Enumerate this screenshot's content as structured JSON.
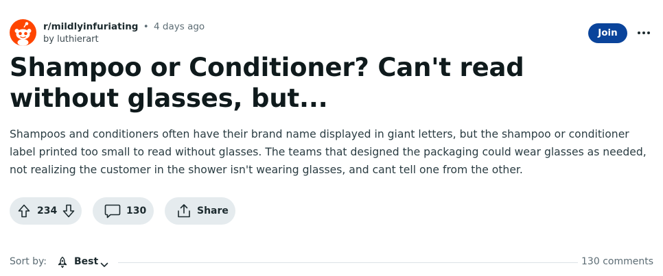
{
  "post": {
    "subreddit": "r/mildlyinfuriating",
    "separator": "•",
    "time_ago": "4 days ago",
    "author": "by luthierart",
    "join_label": "Join",
    "title": "Shampoo or Conditioner? Can't read without glasses, but...",
    "body": "Shampoos and conditioners often have their brand name displayed in giant letters, but the shampoo or conditioner label printed too small to read without glasses. The teams that designed the packaging could wear glasses as needed, not realizing the customer in the shower isn't wearing glasses, and cant tell one from the other."
  },
  "actions": {
    "upvotes": "234",
    "comments": "130",
    "share_label": "Share"
  },
  "sort": {
    "label": "Sort by:",
    "value": "Best",
    "comment_count": "130 comments"
  },
  "icons": {
    "avatar": "subreddit-avatar-icon",
    "upvote": "upvote-arrow-icon",
    "downvote": "downvote-arrow-icon",
    "comment": "comment-bubble-icon",
    "share": "share-icon",
    "sort": "rocket-icon",
    "chevron": "chevron-down-icon",
    "more": "more-options-icon"
  },
  "colors": {
    "join_button": "#0a449b",
    "avatar_bg": "#ff4500",
    "pill_bg": "#e5ebee"
  }
}
